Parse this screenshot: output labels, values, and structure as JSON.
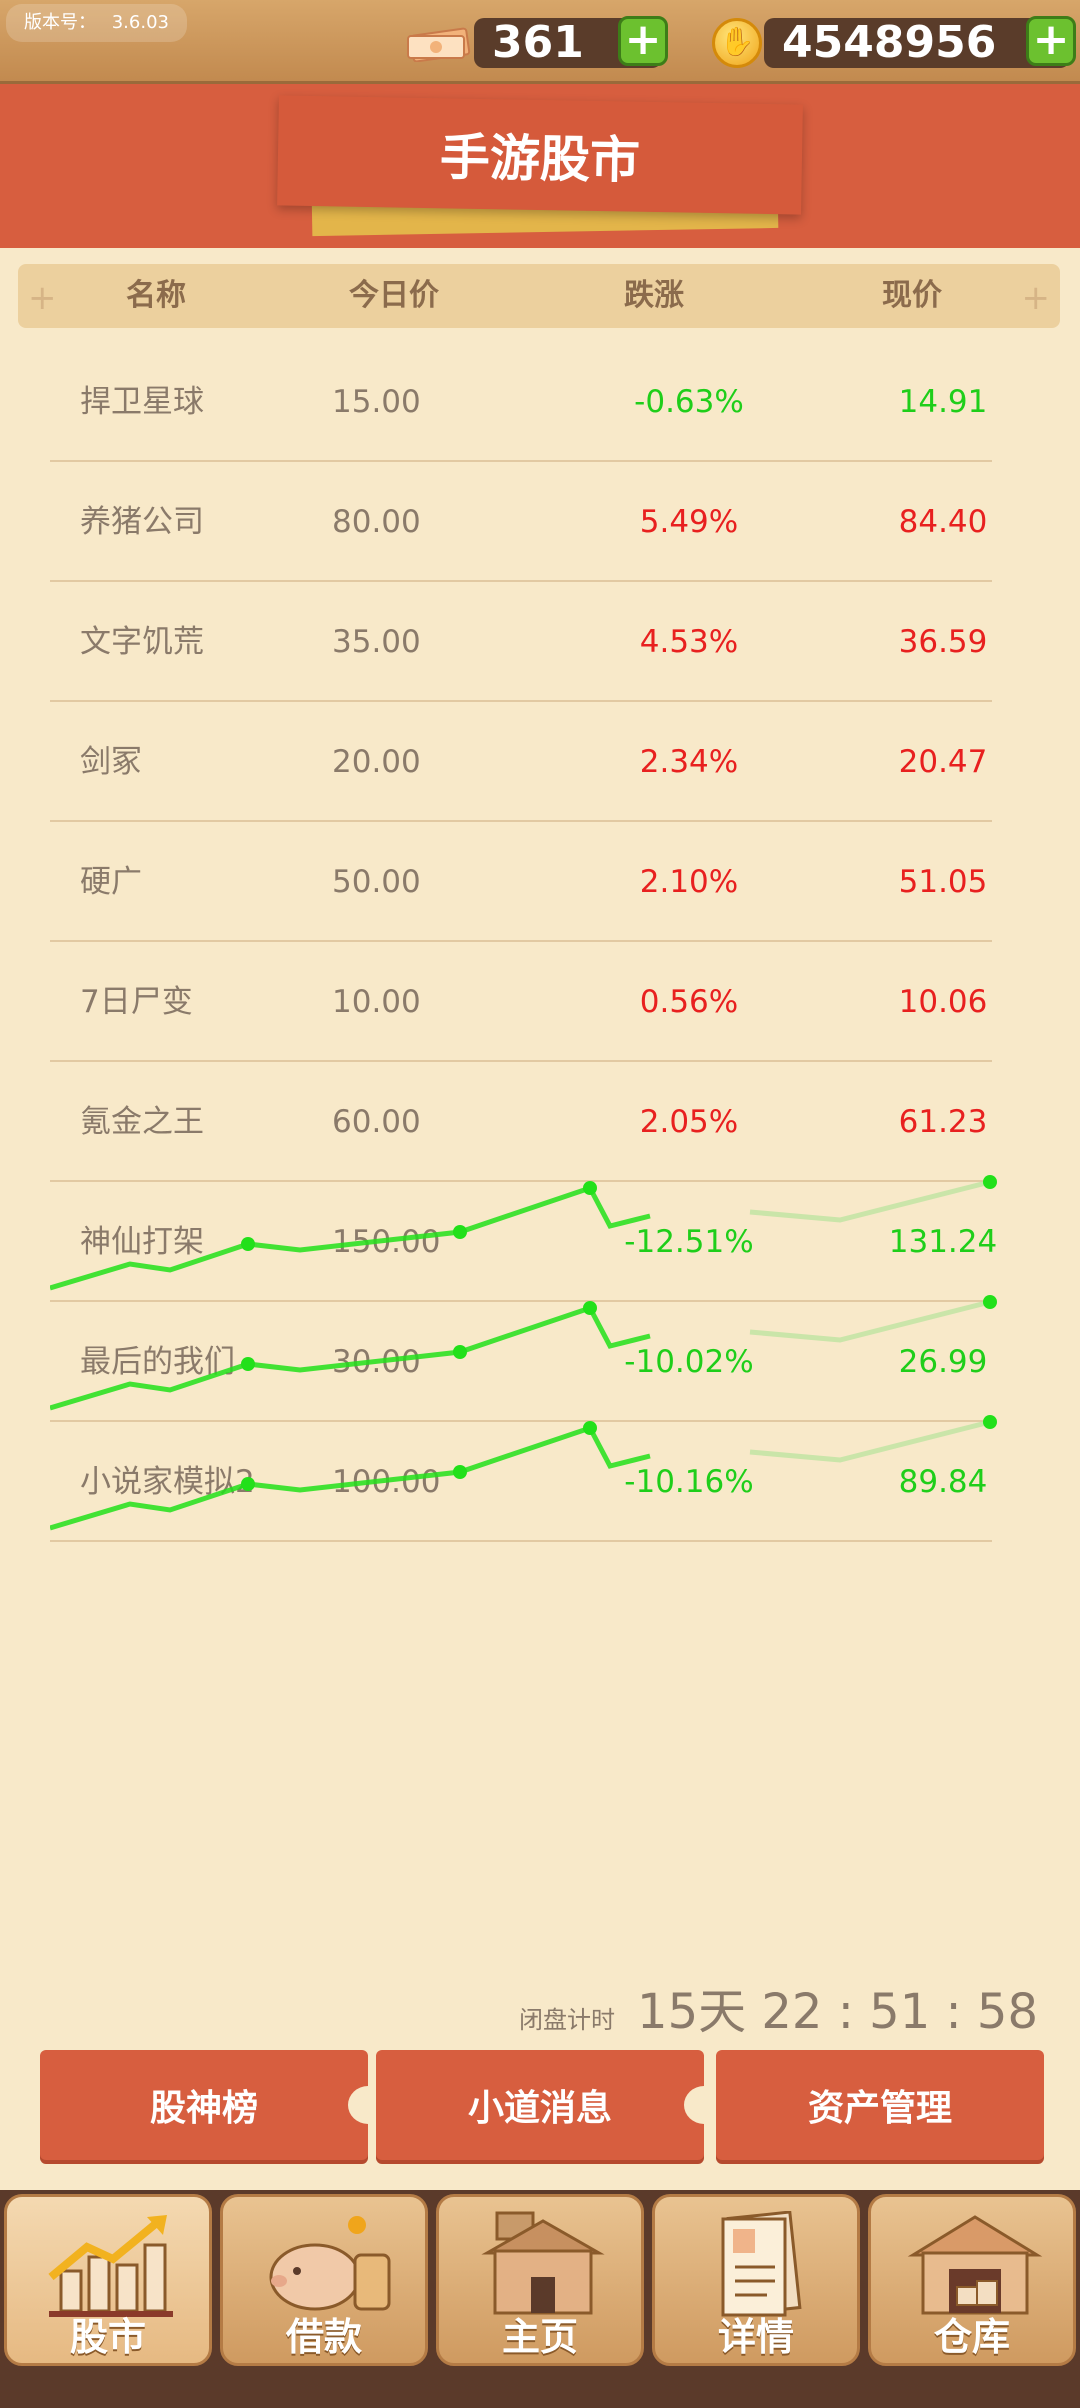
{
  "version": {
    "label": "版本号：",
    "value": "3.6.03"
  },
  "resources": {
    "cash": "361",
    "coins": "4548956"
  },
  "title": "手游股市",
  "table": {
    "headers": [
      "名称",
      "今日价",
      "跌涨",
      "现价"
    ],
    "rows": [
      {
        "name": "捍卫星球",
        "today": "15.00",
        "change": "-0.63%",
        "price": "14.91",
        "trend": "down"
      },
      {
        "name": "养猪公司",
        "today": "80.00",
        "change": "5.49%",
        "price": "84.40",
        "trend": "up"
      },
      {
        "name": "文字饥荒",
        "today": "35.00",
        "change": "4.53%",
        "price": "36.59",
        "trend": "up"
      },
      {
        "name": "剑冢",
        "today": "20.00",
        "change": "2.34%",
        "price": "20.47",
        "trend": "up"
      },
      {
        "name": "硬广",
        "today": "50.00",
        "change": "2.10%",
        "price": "51.05",
        "trend": "up"
      },
      {
        "name": "7日尸变",
        "today": "10.00",
        "change": "0.56%",
        "price": "10.06",
        "trend": "up"
      },
      {
        "name": "氪金之王",
        "today": "60.00",
        "change": "2.05%",
        "price": "61.23",
        "trend": "up"
      },
      {
        "name": "神仙打架",
        "today": "150.00",
        "change": "-12.51%",
        "price": "131.24",
        "trend": "down"
      },
      {
        "name": "最后的我们",
        "today": "30.00",
        "change": "-10.02%",
        "price": "26.99",
        "trend": "down"
      },
      {
        "name": "小说家模拟2",
        "today": "100.00",
        "change": "-10.16%",
        "price": "89.84",
        "trend": "down"
      }
    ]
  },
  "countdown": {
    "label": "闭盘计时",
    "time": "15天 22 : 51 : 58"
  },
  "actions": [
    "股神榜",
    "小道消息",
    "资产管理"
  ],
  "nav": [
    {
      "label": "股市",
      "icon": "stock-chart-icon"
    },
    {
      "label": "借款",
      "icon": "piggy-bank-icon"
    },
    {
      "label": "主页",
      "icon": "house-icon"
    },
    {
      "label": "详情",
      "icon": "document-icon"
    },
    {
      "label": "仓库",
      "icon": "warehouse-icon"
    }
  ],
  "colors": {
    "up": "#e8201f",
    "down": "#1fce1a",
    "accent": "#d75e3f"
  }
}
